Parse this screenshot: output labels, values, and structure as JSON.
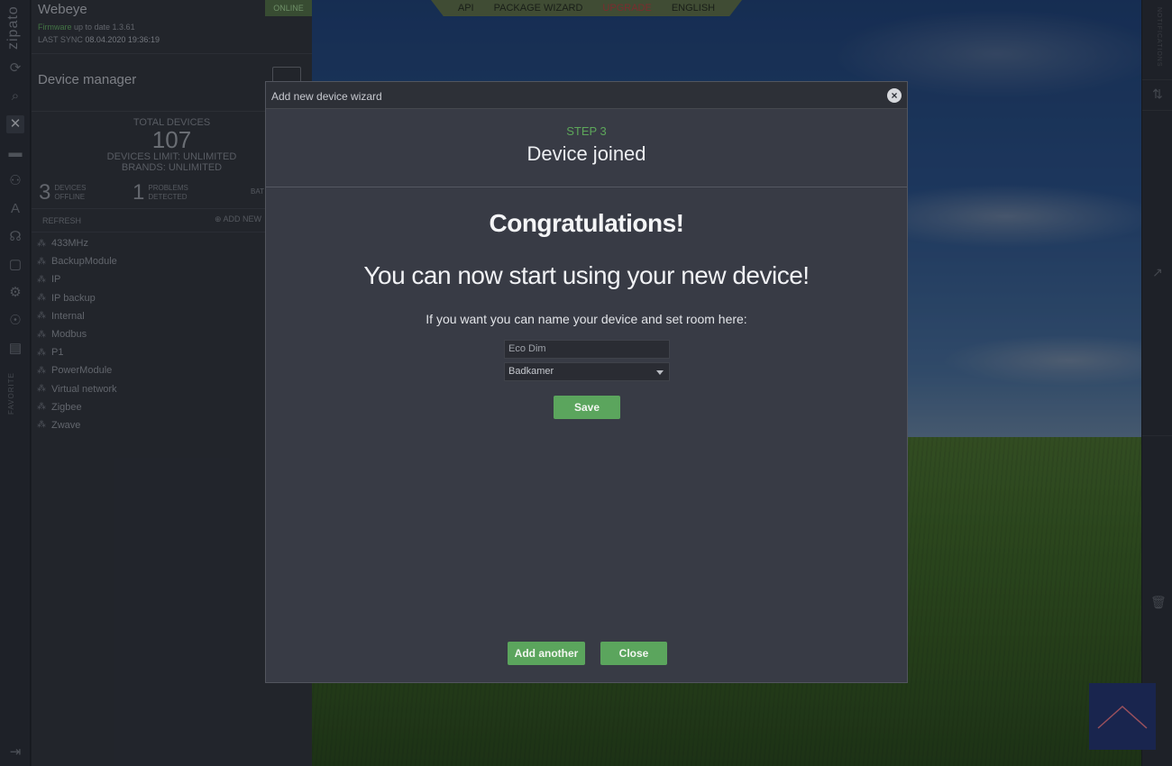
{
  "app": {
    "brand": "zipato"
  },
  "gateway": {
    "name": "Webeye",
    "status": "ONLINE",
    "firmware_label": "Firmware",
    "firmware_text": "up to date 1.3.61",
    "sync_label": "LAST SYNC",
    "sync_value": "08.04.2020 19:36:19"
  },
  "device_manager": {
    "title": "Device manager",
    "total_label": "TOTAL DEVICES",
    "total_value": "107",
    "limit": "DEVICES LIMIT: UNLIMITED",
    "brands": "BRANDS: UNLIMITED",
    "offline_count": "3",
    "offline_label1": "DEVICES",
    "offline_label2": "OFFLINE",
    "problems_count": "1",
    "problems_label1": "PROBLEMS",
    "problems_label2": "DETECTED",
    "bat_label": "BAT",
    "refresh": "REFRESH",
    "add_new": "ADD NEW",
    "networks": [
      "433MHz",
      "BackupModule",
      "IP",
      "IP backup",
      "Internal",
      "Modbus",
      "P1",
      "PowerModule",
      "Virtual network",
      "Zigbee",
      "Zwave"
    ]
  },
  "top_menu": {
    "api": "API",
    "package_wizard": "PACKAGE WIZARD",
    "upgrade": "UPGRADE",
    "language": "ENGLISH"
  },
  "sidebar": {
    "favorite": "FAVORITE"
  },
  "right_rail": {
    "vertical_text": "NOTIFICATIONS"
  },
  "modal": {
    "title": "Add new device wizard",
    "step": "STEP 3",
    "subtitle": "Device joined",
    "congrats": "Congratulations!",
    "message": "You can now start using your new device!",
    "hint": "If you want you can name your device and set room here:",
    "device_name_value": "Eco Dim",
    "room_value": "Badkamer",
    "save_label": "Save",
    "add_another_label": "Add another",
    "close_label": "Close"
  },
  "colors": {
    "accent_green": "#5ba55d",
    "online_green": "#4d6b3f",
    "upgrade_red": "#b23a3a"
  }
}
